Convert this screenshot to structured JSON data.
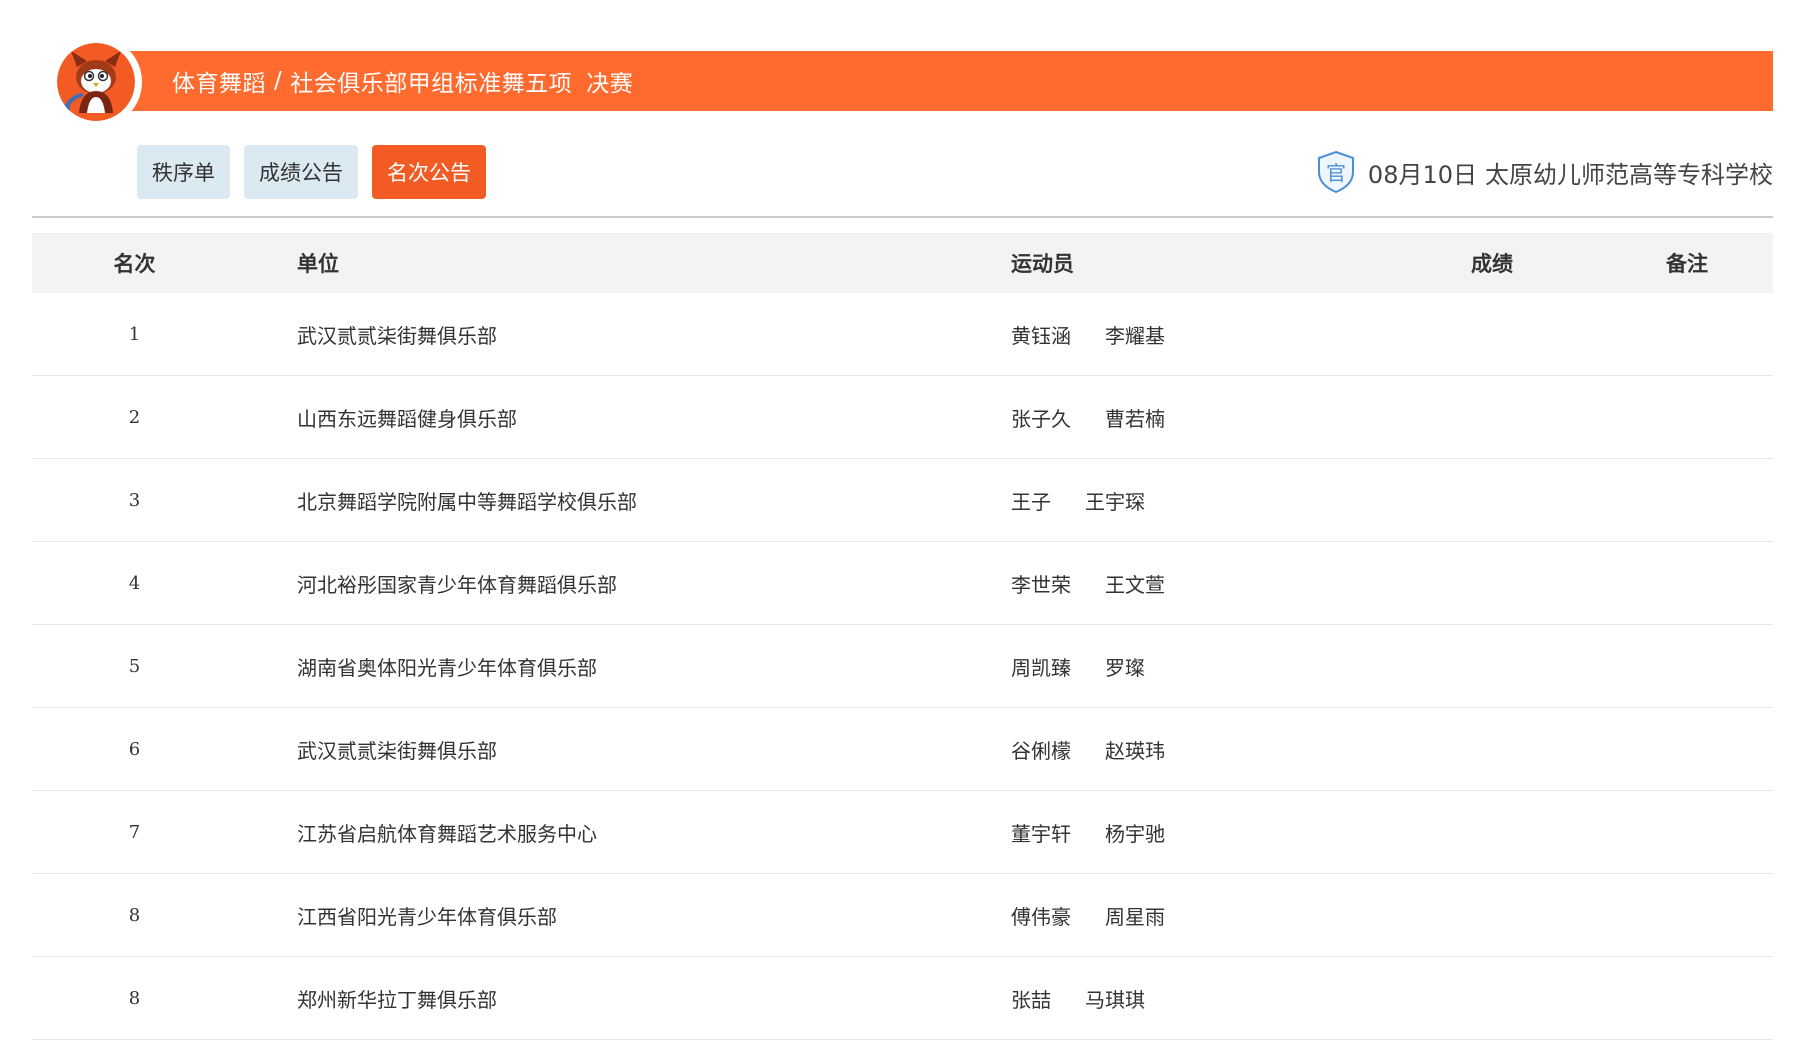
{
  "header": {
    "category": "体育舞蹈",
    "separator": "/",
    "event": "社会俱乐部甲组标准舞五项",
    "round": "决赛",
    "banner_color": "#ff6a2e",
    "logo_icon": "mascot-logo-icon"
  },
  "tabs": [
    {
      "label": "秩序单",
      "active": false
    },
    {
      "label": "成绩公告",
      "active": false
    },
    {
      "label": "名次公告",
      "active": true
    }
  ],
  "event_info": {
    "badge_icon": "official-shield-icon",
    "badge_text": "官",
    "date": "08月10日",
    "venue": "太原幼儿师范高等专科学校"
  },
  "table": {
    "columns": [
      "名次",
      "单位",
      "运动员",
      "成绩",
      "备注"
    ],
    "rows": [
      {
        "rank": "1",
        "unit": "武汉贰贰柒街舞俱乐部",
        "athletes": [
          "黄钰涵",
          "李耀基"
        ],
        "score": "",
        "note": ""
      },
      {
        "rank": "2",
        "unit": "山西东远舞蹈健身俱乐部",
        "athletes": [
          "张子久",
          "曹若楠"
        ],
        "score": "",
        "note": ""
      },
      {
        "rank": "3",
        "unit": "北京舞蹈学院附属中等舞蹈学校俱乐部",
        "athletes": [
          "王子",
          "王宇琛"
        ],
        "score": "",
        "note": ""
      },
      {
        "rank": "4",
        "unit": "河北裕彤国家青少年体育舞蹈俱乐部",
        "athletes": [
          "李世荣",
          "王文萱"
        ],
        "score": "",
        "note": ""
      },
      {
        "rank": "5",
        "unit": "湖南省奥体阳光青少年体育俱乐部",
        "athletes": [
          "周凯臻",
          "罗璨"
        ],
        "score": "",
        "note": ""
      },
      {
        "rank": "6",
        "unit": "武汉贰贰柒街舞俱乐部",
        "athletes": [
          "谷俐檬",
          "赵瑛玮"
        ],
        "score": "",
        "note": ""
      },
      {
        "rank": "7",
        "unit": "江苏省启航体育舞蹈艺术服务中心",
        "athletes": [
          "董宇轩",
          "杨宇驰"
        ],
        "score": "",
        "note": ""
      },
      {
        "rank": "8",
        "unit": "江西省阳光青少年体育俱乐部",
        "athletes": [
          "傅伟豪",
          "周星雨"
        ],
        "score": "",
        "note": ""
      },
      {
        "rank": "8",
        "unit": "郑州新华拉丁舞俱乐部",
        "athletes": [
          "张喆",
          "马琪琪"
        ],
        "score": "",
        "note": ""
      }
    ]
  }
}
